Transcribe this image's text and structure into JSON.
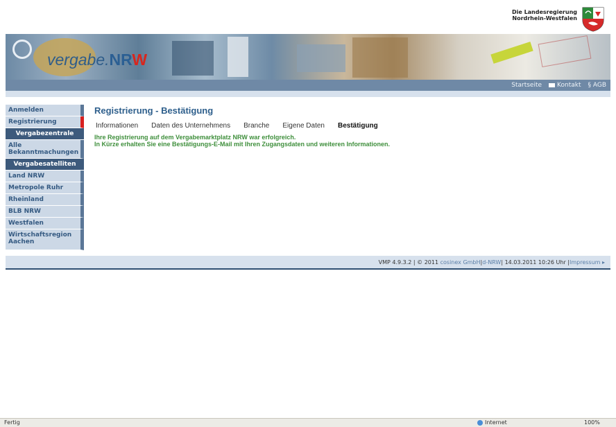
{
  "header": {
    "gov_line1": "Die Landesregierung",
    "gov_line2": "Nordrhein-Westfalen"
  },
  "logo": {
    "prefix": "vergabe.",
    "brand_nr": "NR",
    "brand_w": "W"
  },
  "topnav": {
    "items": [
      "Startseite",
      "Kontakt",
      "§ AGB"
    ]
  },
  "sidebar": {
    "items": [
      {
        "label": "Anmelden",
        "type": "link"
      },
      {
        "label": "Registrierung",
        "type": "link",
        "active": true
      },
      {
        "label": "Vergabezentrale",
        "type": "header"
      },
      {
        "label": "Alle Bekanntmachungen",
        "type": "link"
      },
      {
        "label": "Vergabesatelliten",
        "type": "header"
      },
      {
        "label": "Land NRW",
        "type": "link"
      },
      {
        "label": "Metropole Ruhr",
        "type": "link"
      },
      {
        "label": "Rheinland",
        "type": "link"
      },
      {
        "label": "BLB NRW",
        "type": "link"
      },
      {
        "label": "Westfalen",
        "type": "link"
      },
      {
        "label": "Wirtschaftsregion Aachen",
        "type": "link"
      }
    ]
  },
  "main": {
    "title": "Registrierung - Bestätigung",
    "steps": [
      "Informationen",
      "Daten des Unternehmens",
      "Branche",
      "Eigene Daten",
      "Bestätigung"
    ],
    "current_step": "Bestätigung",
    "message_line1": "Ihre Registrierung auf dem Vergabemarktplatz NRW war erfolgreich.",
    "message_line2": "In Kürze erhalten Sie eine Bestätigungs-E-Mail mit Ihren Zugangsdaten und weiteren Informationen."
  },
  "footer": {
    "version": "VMP 4.9.3.2 | © 2011",
    "company": "cosinex GmbH",
    "sep1": " | ",
    "dnrw": "d-NRW",
    "datetime": " | 14.03.2011 10:26 Uhr | ",
    "impressum": "Impressum",
    "arrow": "▸"
  },
  "statusbar": {
    "left": "Fertig",
    "zone": "Internet",
    "zoom": "100%"
  },
  "colors": {
    "accent": "#2e5f8c",
    "success": "#3f8f3c",
    "nav": "#6f89a6",
    "sidebar": "#ccd8e6",
    "active_marker": "#d82020"
  }
}
